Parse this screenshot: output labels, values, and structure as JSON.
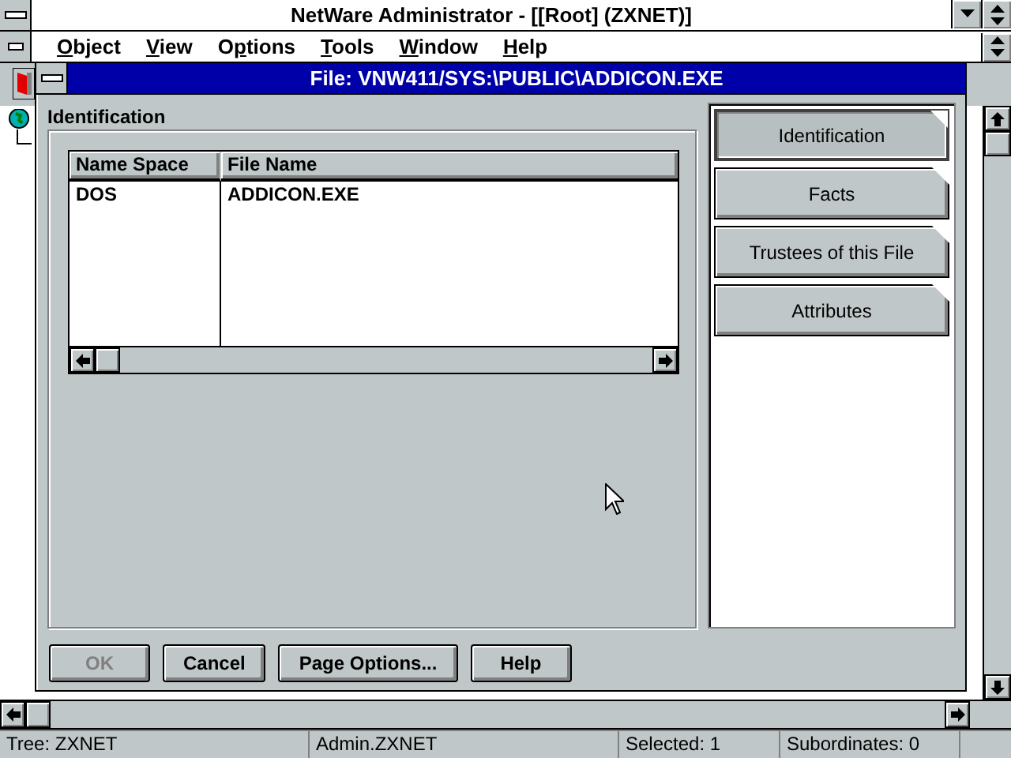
{
  "app_window": {
    "title": "NetWare Administrator - [[Root] (ZXNET)]"
  },
  "menu": [
    {
      "mnemonic": "O",
      "after": "bject"
    },
    {
      "mnemonic": "V",
      "after": "iew"
    },
    {
      "before": "O",
      "mnemonic": "p",
      "after": "tions"
    },
    {
      "mnemonic": "T",
      "after": "ools"
    },
    {
      "mnemonic": "W",
      "after": "indow"
    },
    {
      "mnemonic": "H",
      "after": "elp"
    }
  ],
  "dialog": {
    "title": "File: VNW411/SYS:\\PUBLIC\\ADDICON.EXE",
    "section": "Identification",
    "table": {
      "columns": [
        "Name Space",
        "File Name"
      ],
      "rows": [
        [
          "DOS",
          "ADDICON.EXE"
        ]
      ]
    },
    "pages": [
      {
        "label": "Identification",
        "selected": true
      },
      {
        "label": "Facts",
        "selected": false
      },
      {
        "label": "Trustees of this File",
        "selected": false
      },
      {
        "label": "Attributes",
        "selected": false
      }
    ],
    "buttons": [
      {
        "label": "OK",
        "disabled": true
      },
      {
        "label": "Cancel",
        "disabled": false
      },
      {
        "label": "Page Options...",
        "disabled": false
      },
      {
        "label": "Help",
        "disabled": false
      }
    ]
  },
  "status_bar": [
    "Tree: ZXNET",
    "Admin.ZXNET",
    "Selected: 1",
    "Subordinates: 0"
  ]
}
